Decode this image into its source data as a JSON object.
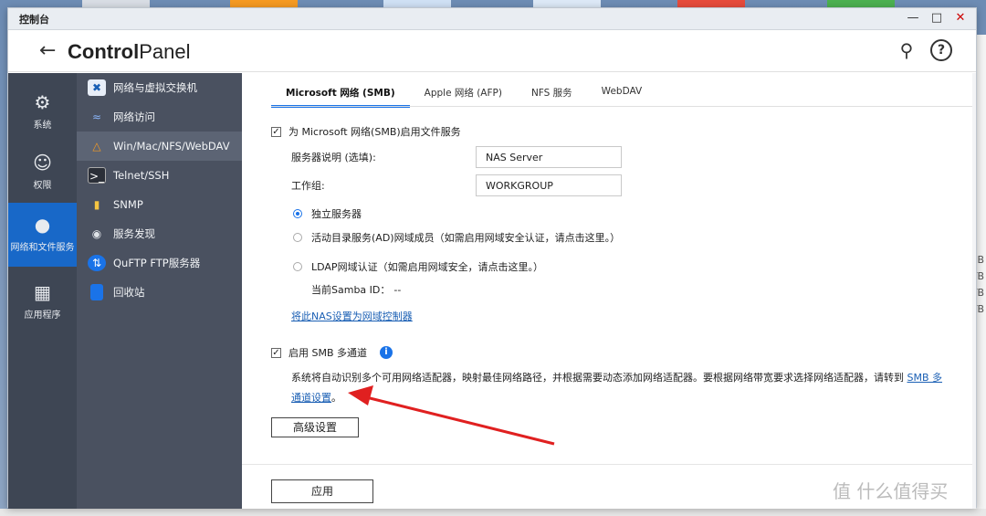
{
  "window": {
    "title": "控制台"
  },
  "header": {
    "app_title_bold": "Control",
    "app_title_rest": "Panel"
  },
  "nav": {
    "items": [
      {
        "label": "系统",
        "icon": "gear-icon"
      },
      {
        "label": "权限",
        "icon": "user-icon"
      },
      {
        "label": "网络和文件服务",
        "icon": "globe-icon"
      },
      {
        "label": "应用程序",
        "icon": "apps-icon"
      }
    ]
  },
  "submenu": {
    "items": [
      {
        "label": "网络与虚拟交换机",
        "icon": "network-switch-icon"
      },
      {
        "label": "网络访问",
        "icon": "network-access-icon"
      },
      {
        "label": "Win/Mac/NFS/WebDAV",
        "icon": "file-service-icon"
      },
      {
        "label": "Telnet/SSH",
        "icon": "terminal-icon"
      },
      {
        "label": "SNMP",
        "icon": "snmp-icon"
      },
      {
        "label": "服务发现",
        "icon": "service-discovery-icon"
      },
      {
        "label": "QuFTP FTP服务器",
        "icon": "ftp-icon"
      },
      {
        "label": "回收站",
        "icon": "recycle-bin-icon"
      }
    ]
  },
  "tabs": [
    "Microsoft 网络 (SMB)",
    "Apple 网络 (AFP)",
    "NFS 服务",
    "WebDAV"
  ],
  "smb": {
    "enable_label": "为 Microsoft 网络(SMB)启用文件服务",
    "server_desc_label": "服务器说明 (选填):",
    "server_desc_value": "NAS Server",
    "workgroup_label": "工作组:",
    "workgroup_value": "WORKGROUP",
    "standalone_label": "独立服务器",
    "ad_label": "活动目录服务(AD)网域成员（如需启用网域安全认证，请点击这里。）",
    "ldap_label": "LDAP网域认证（如需启用网域安全，请点击这里。）",
    "samba_id_label": "当前Samba ID：",
    "samba_id_value": "--",
    "dc_link": "将此NAS设置为网域控制器",
    "multichannel_label": "启用 SMB 多通道",
    "multichannel_desc": "系统将自动识别多个可用网络适配器，映射最佳网络路径，并根据需要动态添加网络适配器。要根据网络带宽要求选择网络适配器，请转到 ",
    "multichannel_link_1": "SMB 多",
    "multichannel_link_2": "通道设置",
    "multichannel_end": "。",
    "advanced_button": "高级设置"
  },
  "apply_button": "应用",
  "right_strip": [
    "GB",
    "TB",
    "TB",
    "TB"
  ],
  "watermark": "值 什么值得买",
  "colors": {
    "accent": "#1a73e8",
    "nav_bg": "#3e4654",
    "nav_active": "#1868c8",
    "arrow": "#e02020"
  }
}
